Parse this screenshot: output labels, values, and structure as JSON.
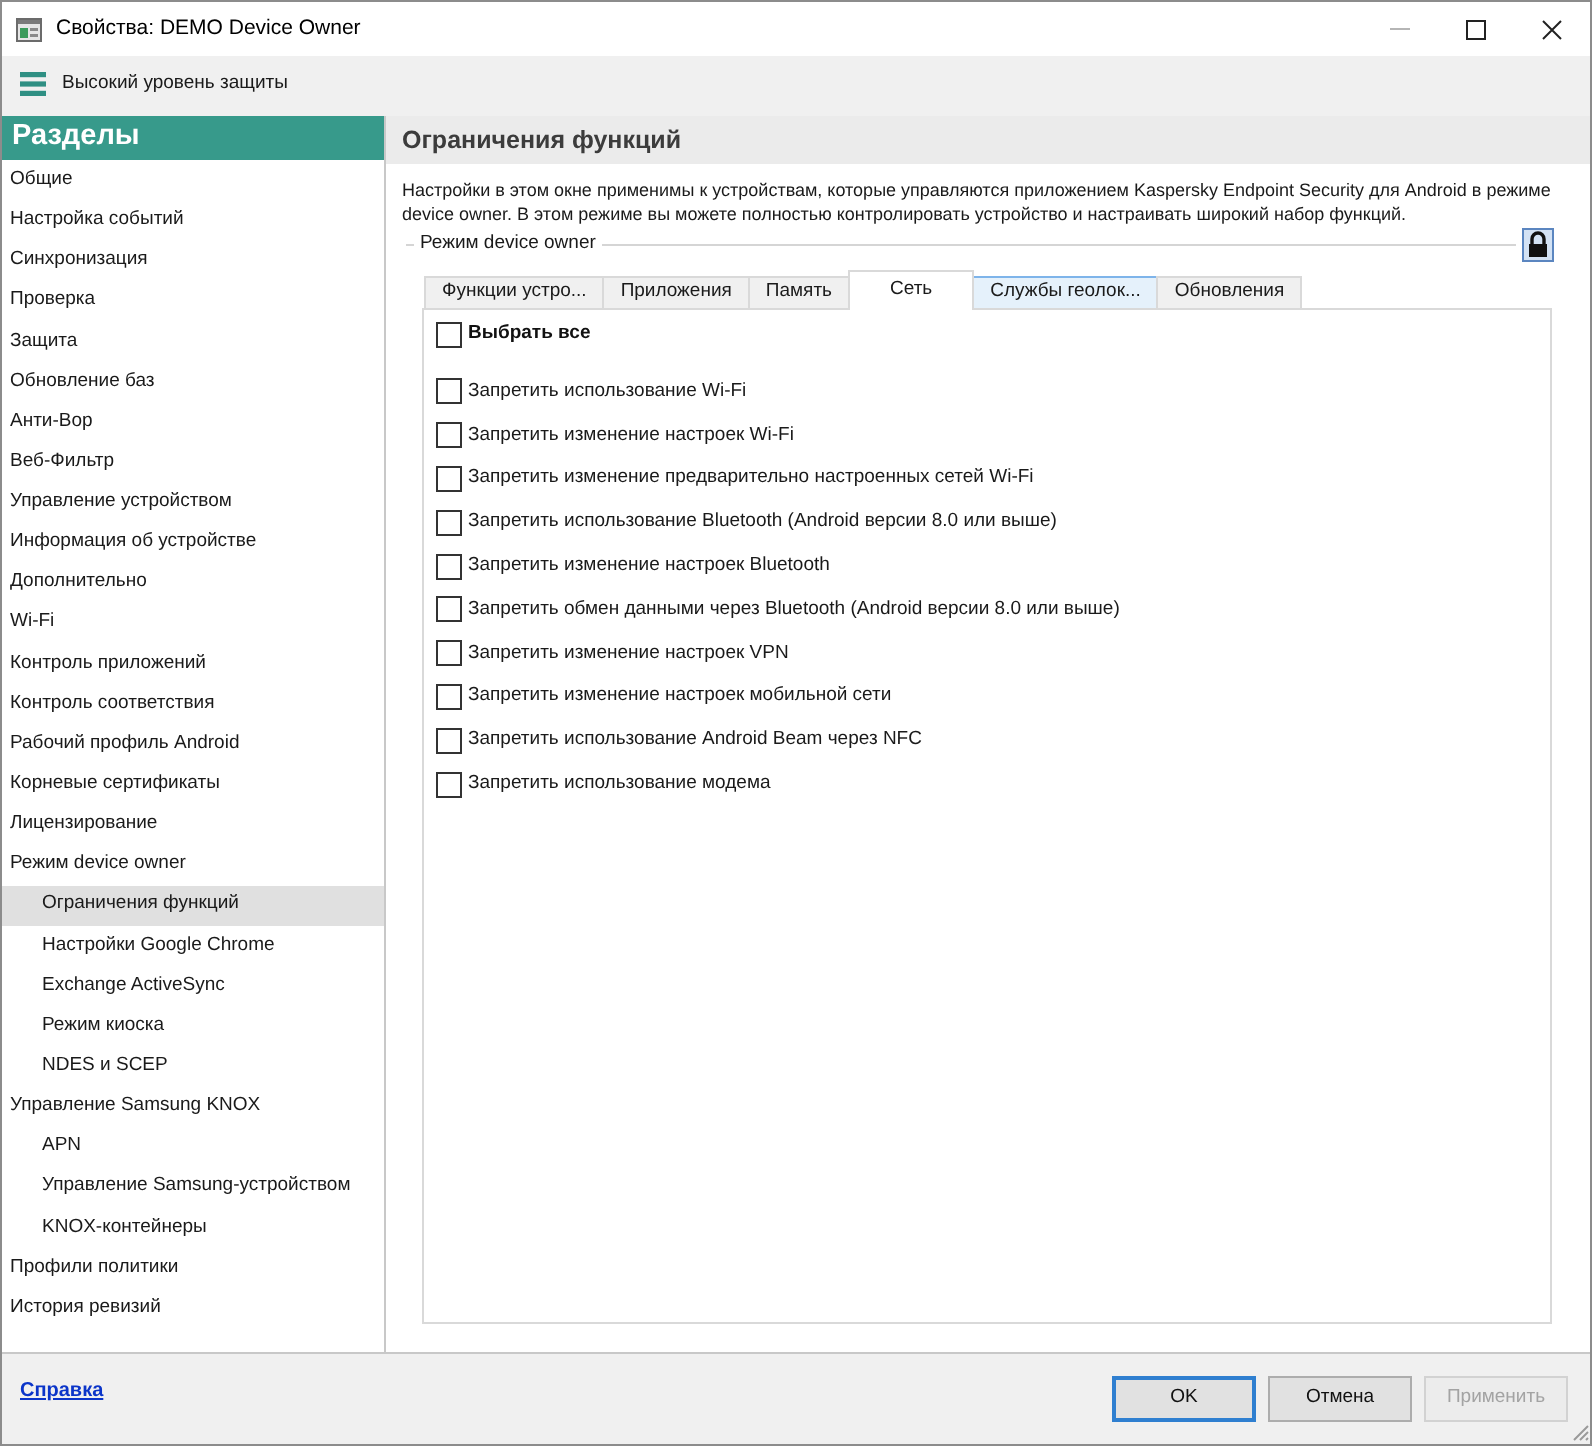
{
  "window": {
    "title": "Свойства: DEMO Device Owner"
  },
  "toolbar": {
    "label": "Высокий уровень защиты"
  },
  "sidebar": {
    "header": "Разделы",
    "items": [
      {
        "label": "Общие",
        "selected": false
      },
      {
        "label": "Настройка событий",
        "selected": false
      },
      {
        "label": "Синхронизация",
        "selected": false
      },
      {
        "label": "Проверка",
        "selected": false
      },
      {
        "label": "Защита",
        "selected": false
      },
      {
        "label": "Обновление баз",
        "selected": false
      },
      {
        "label": "Анти-Вор",
        "selected": false
      },
      {
        "label": "Веб-Фильтр",
        "selected": false
      },
      {
        "label": "Управление устройством",
        "selected": false
      },
      {
        "label": "Информация об устройстве",
        "selected": false
      },
      {
        "label": "Дополнительно",
        "selected": false
      },
      {
        "label": "Wi-Fi",
        "selected": false
      },
      {
        "label": "Контроль приложений",
        "selected": false
      },
      {
        "label": "Контроль соответствия",
        "selected": false
      },
      {
        "label": "Рабочий профиль Android",
        "selected": false
      },
      {
        "label": "Корневые сертификаты",
        "selected": false
      },
      {
        "label": "Лицензирование",
        "selected": false
      },
      {
        "label": "Режим device owner",
        "selected": false,
        "children": [
          {
            "label": "Ограничения функций",
            "selected": true
          },
          {
            "label": "Настройки Google Chrome",
            "selected": false
          },
          {
            "label": "Exchange ActiveSync",
            "selected": false
          },
          {
            "label": "Режим киоска",
            "selected": false
          },
          {
            "label": "NDES и SCEP",
            "selected": false
          }
        ]
      },
      {
        "label": "Управление Samsung KNOX",
        "selected": false,
        "children": [
          {
            "label": "APN",
            "selected": false
          },
          {
            "label": "Управление Samsung-устройством",
            "selected": false
          },
          {
            "label": "KNOX-контейнеры",
            "selected": false
          }
        ]
      },
      {
        "label": "Профили политики",
        "selected": false
      },
      {
        "label": "История ревизий",
        "selected": false
      }
    ]
  },
  "panel": {
    "title": "Ограничения функций",
    "description": "Настройки в этом окне применимы к устройствам, которые управляются приложением Kaspersky Endpoint Security для Android в режиме device owner. В этом режиме вы можете полностью контролировать устройство и настраивать широкий набор функций.",
    "group_label": "Режим device owner",
    "locked": true,
    "tabs": [
      {
        "label": "Функции устро...",
        "selected": false,
        "hovered": false
      },
      {
        "label": "Приложения",
        "selected": false,
        "hovered": false
      },
      {
        "label": "Память",
        "selected": false,
        "hovered": false
      },
      {
        "label": "Сеть",
        "selected": true,
        "hovered": false
      },
      {
        "label": "Службы геолок...",
        "selected": false,
        "hovered": true
      },
      {
        "label": "Обновления",
        "selected": false,
        "hovered": false
      }
    ],
    "select_all": {
      "label": "Выбрать все",
      "checked": false
    },
    "options": [
      {
        "label": "Запретить использование Wi-Fi",
        "checked": false
      },
      {
        "label": "Запретить изменение настроек Wi-Fi",
        "checked": false
      },
      {
        "label": "Запретить изменение предварительно настроенных сетей Wi-Fi",
        "checked": false
      },
      {
        "label": "Запретить использование Bluetooth (Android версии 8.0 или выше)",
        "checked": false
      },
      {
        "label": "Запретить изменение настроек Bluetooth",
        "checked": false
      },
      {
        "label": "Запретить обмен данными через Bluetooth (Android версии 8.0 или выше)",
        "checked": false
      },
      {
        "label": "Запретить изменение настроек VPN",
        "checked": false
      },
      {
        "label": "Запретить изменение настроек мобильной сети",
        "checked": false
      },
      {
        "label": "Запретить использование Android Beam через NFC",
        "checked": false
      },
      {
        "label": "Запретить использование модема",
        "checked": false
      }
    ]
  },
  "footer": {
    "help_link": "Справка",
    "buttons": [
      {
        "label": "OK",
        "focused": true,
        "disabled": false
      },
      {
        "label": "Отмена",
        "focused": false,
        "disabled": false
      },
      {
        "label": "Применить",
        "focused": false,
        "disabled": true
      }
    ]
  }
}
